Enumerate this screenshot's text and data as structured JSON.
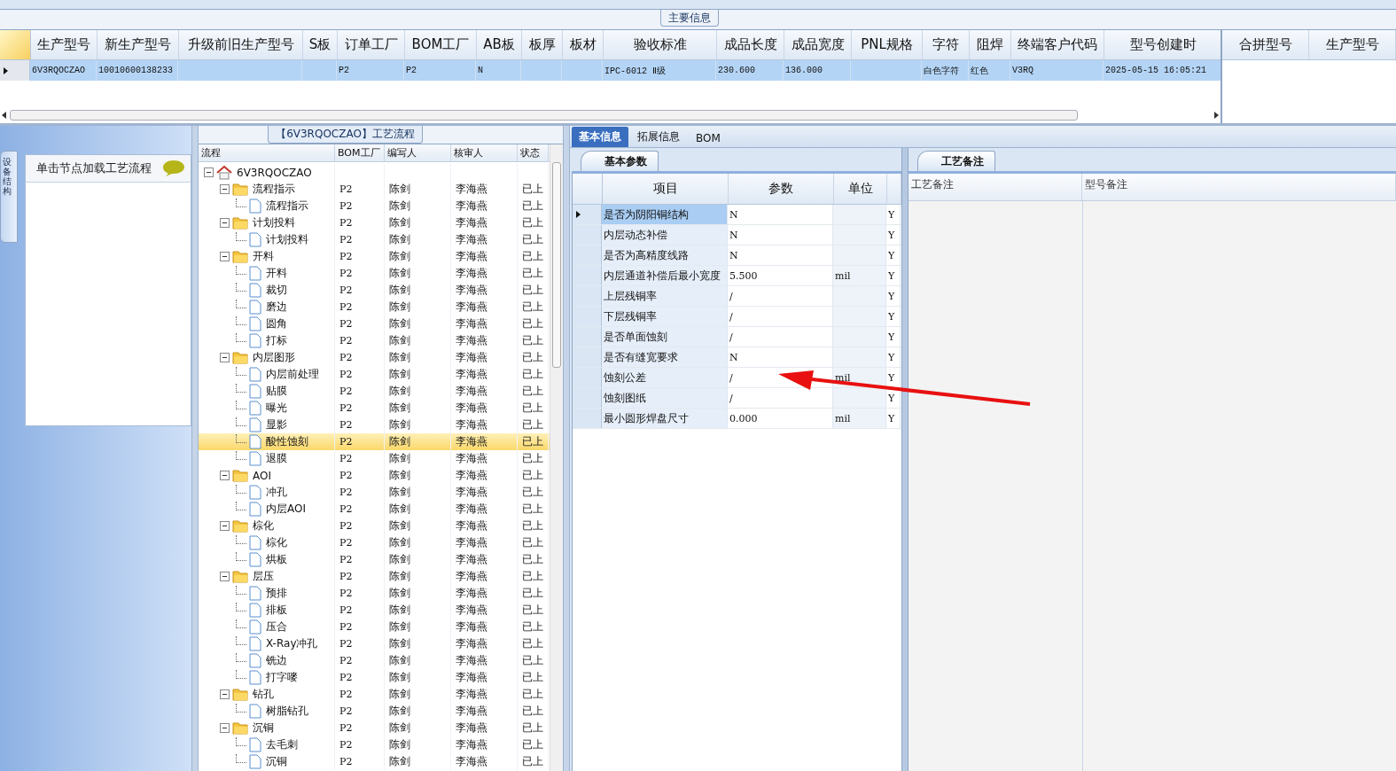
{
  "main_info": {
    "title": "主要信息",
    "columns": [
      "生产型号",
      "新生产型号",
      "升级前旧生产型号",
      "S板",
      "订单工厂",
      "BOM工厂",
      "AB板",
      "板厚",
      "板材",
      "验收标准",
      "成品长度",
      "成品宽度",
      "PNL规格",
      "字符",
      "阻焊",
      "终端客户代码",
      "型号创建时"
    ],
    "rows": [
      {
        "selected": true,
        "cells": [
          "6V3RQOCZAO",
          "10010600138233",
          "",
          "",
          "P2",
          "P2",
          "N",
          "",
          "",
          "IPC-6012 Ⅱ级",
          "230.600",
          "136.000",
          "",
          "白色字符",
          "红色",
          "V3RQ",
          "2025-05-15 16:05:21"
        ]
      }
    ],
    "side_columns": [
      "合拼型号",
      "生产型号"
    ]
  },
  "left_panel": {
    "tab": "设备结构",
    "hint": "单击节点加载工艺流程"
  },
  "process_flow": {
    "title": "【6V3RQOCZAO】工艺流程",
    "columns": [
      "流程",
      "BOM工厂",
      "编写人",
      "核审人",
      "状态"
    ],
    "root": {
      "kind": "root",
      "label": "6V3RQOCZAO",
      "expanded": true,
      "selected": false,
      "children": [
        {
          "kind": "folder",
          "label": "流程指示",
          "bom": "P2",
          "writer": "陈剑",
          "reviewer": "李海燕",
          "status": "已上",
          "expanded": true,
          "selected": false,
          "children": [
            {
              "kind": "file",
              "label": "流程指示",
              "bom": "P2",
              "writer": "陈剑",
              "reviewer": "李海燕",
              "status": "已上",
              "selected": false
            }
          ]
        },
        {
          "kind": "folder",
          "label": "计划投料",
          "bom": "P2",
          "writer": "陈剑",
          "reviewer": "李海燕",
          "status": "已上",
          "expanded": true,
          "selected": false,
          "children": [
            {
              "kind": "file",
              "label": "计划投料",
              "bom": "P2",
              "writer": "陈剑",
              "reviewer": "李海燕",
              "status": "已上",
              "selected": false
            }
          ]
        },
        {
          "kind": "folder",
          "label": "开料",
          "bom": "P2",
          "writer": "陈剑",
          "reviewer": "李海燕",
          "status": "已上",
          "expanded": true,
          "selected": false,
          "children": [
            {
              "kind": "file",
              "label": "开料",
              "bom": "P2",
              "writer": "陈剑",
              "reviewer": "李海燕",
              "status": "已上",
              "selected": false
            },
            {
              "kind": "file",
              "label": "裁切",
              "bom": "P2",
              "writer": "陈剑",
              "reviewer": "李海燕",
              "status": "已上",
              "selected": false
            },
            {
              "kind": "file",
              "label": "磨边",
              "bom": "P2",
              "writer": "陈剑",
              "reviewer": "李海燕",
              "status": "已上",
              "selected": false
            },
            {
              "kind": "file",
              "label": "圆角",
              "bom": "P2",
              "writer": "陈剑",
              "reviewer": "李海燕",
              "status": "已上",
              "selected": false
            },
            {
              "kind": "file",
              "label": "打标",
              "bom": "P2",
              "writer": "陈剑",
              "reviewer": "李海燕",
              "status": "已上",
              "selected": false
            }
          ]
        },
        {
          "kind": "folder",
          "label": "内层图形",
          "bom": "P2",
          "writer": "陈剑",
          "reviewer": "李海燕",
          "status": "已上",
          "expanded": true,
          "selected": false,
          "children": [
            {
              "kind": "file",
              "label": "内层前处理",
              "bom": "P2",
              "writer": "陈剑",
              "reviewer": "李海燕",
              "status": "已上",
              "selected": false
            },
            {
              "kind": "file",
              "label": "贴膜",
              "bom": "P2",
              "writer": "陈剑",
              "reviewer": "李海燕",
              "status": "已上",
              "selected": false
            },
            {
              "kind": "file",
              "label": "曝光",
              "bom": "P2",
              "writer": "陈剑",
              "reviewer": "李海燕",
              "status": "已上",
              "selected": false
            },
            {
              "kind": "file",
              "label": "显影",
              "bom": "P2",
              "writer": "陈剑",
              "reviewer": "李海燕",
              "status": "已上",
              "selected": false
            },
            {
              "kind": "file",
              "label": "酸性蚀刻",
              "bom": "P2",
              "writer": "陈剑",
              "reviewer": "李海燕",
              "status": "已上",
              "selected": true
            },
            {
              "kind": "file",
              "label": "退膜",
              "bom": "P2",
              "writer": "陈剑",
              "reviewer": "李海燕",
              "status": "已上",
              "selected": false
            }
          ]
        },
        {
          "kind": "folder",
          "label": "AOI",
          "bom": "P2",
          "writer": "陈剑",
          "reviewer": "李海燕",
          "status": "已上",
          "expanded": true,
          "selected": false,
          "children": [
            {
              "kind": "file",
              "label": "冲孔",
              "bom": "P2",
              "writer": "陈剑",
              "reviewer": "李海燕",
              "status": "已上",
              "selected": false
            },
            {
              "kind": "file",
              "label": "内层AOI",
              "bom": "P2",
              "writer": "陈剑",
              "reviewer": "李海燕",
              "status": "已上",
              "selected": false
            }
          ]
        },
        {
          "kind": "folder",
          "label": "棕化",
          "bom": "P2",
          "writer": "陈剑",
          "reviewer": "李海燕",
          "status": "已上",
          "expanded": true,
          "selected": false,
          "children": [
            {
              "kind": "file",
              "label": "棕化",
              "bom": "P2",
              "writer": "陈剑",
              "reviewer": "李海燕",
              "status": "已上",
              "selected": false
            },
            {
              "kind": "file",
              "label": "烘板",
              "bom": "P2",
              "writer": "陈剑",
              "reviewer": "李海燕",
              "status": "已上",
              "selected": false
            }
          ]
        },
        {
          "kind": "folder",
          "label": "层压",
          "bom": "P2",
          "writer": "陈剑",
          "reviewer": "李海燕",
          "status": "已上",
          "expanded": true,
          "selected": false,
          "children": [
            {
              "kind": "file",
              "label": "预排",
              "bom": "P2",
              "writer": "陈剑",
              "reviewer": "李海燕",
              "status": "已上",
              "selected": false
            },
            {
              "kind": "file",
              "label": "排板",
              "bom": "P2",
              "writer": "陈剑",
              "reviewer": "李海燕",
              "status": "已上",
              "selected": false
            },
            {
              "kind": "file",
              "label": "压合",
              "bom": "P2",
              "writer": "陈剑",
              "reviewer": "李海燕",
              "status": "已上",
              "selected": false
            },
            {
              "kind": "file",
              "label": "X-Ray冲孔",
              "bom": "P2",
              "writer": "陈剑",
              "reviewer": "李海燕",
              "status": "已上",
              "selected": false
            },
            {
              "kind": "file",
              "label": "铣边",
              "bom": "P2",
              "writer": "陈剑",
              "reviewer": "李海燕",
              "status": "已上",
              "selected": false
            },
            {
              "kind": "file",
              "label": "打字嘜",
              "bom": "P2",
              "writer": "陈剑",
              "reviewer": "李海燕",
              "status": "已上",
              "selected": false
            }
          ]
        },
        {
          "kind": "folder",
          "label": "钻孔",
          "bom": "P2",
          "writer": "陈剑",
          "reviewer": "李海燕",
          "status": "已上",
          "expanded": true,
          "selected": false,
          "children": [
            {
              "kind": "file",
              "label": "树脂钻孔",
              "bom": "P2",
              "writer": "陈剑",
              "reviewer": "李海燕",
              "status": "已上",
              "selected": false
            }
          ]
        },
        {
          "kind": "folder",
          "label": "沉铜",
          "bom": "P2",
          "writer": "陈剑",
          "reviewer": "李海燕",
          "status": "已上",
          "expanded": true,
          "selected": false,
          "children": [
            {
              "kind": "file",
              "label": "去毛刺",
              "bom": "P2",
              "writer": "陈剑",
              "reviewer": "李海燕",
              "status": "已上",
              "selected": false
            },
            {
              "kind": "file",
              "label": "沉铜",
              "bom": "P2",
              "writer": "陈剑",
              "reviewer": "李海燕",
              "status": "已上",
              "selected": false
            }
          ]
        }
      ]
    }
  },
  "detail_tabs": [
    {
      "label": "基本信息",
      "selected": true
    },
    {
      "label": "拓展信息",
      "selected": false
    },
    {
      "label": "BOM",
      "selected": false
    }
  ],
  "basic_params": {
    "tab": "基本参数",
    "columns": [
      "项目",
      "参数",
      "单位"
    ],
    "rows": [
      {
        "item": "是否为阴阳铜结构",
        "value": "N",
        "unit": "",
        "flag": "Y",
        "selected": true
      },
      {
        "item": "内层动态补偿",
        "value": "N",
        "unit": "",
        "flag": "Y",
        "selected": false
      },
      {
        "item": "是否为高精度线路",
        "value": "N",
        "unit": "",
        "flag": "Y",
        "selected": false
      },
      {
        "item": "内层通道补偿后最小宽度",
        "value": "5.500",
        "unit": "mil",
        "flag": "Y",
        "selected": false
      },
      {
        "item": "上层残铜率",
        "value": "/",
        "unit": "",
        "flag": "Y",
        "selected": false
      },
      {
        "item": "下层残铜率",
        "value": "/",
        "unit": "",
        "flag": "Y",
        "selected": false
      },
      {
        "item": "是否单面蚀刻",
        "value": "/",
        "unit": "",
        "flag": "Y",
        "selected": false
      },
      {
        "item": "是否有缝宽要求",
        "value": "N",
        "unit": "",
        "flag": "Y",
        "selected": false
      },
      {
        "item": "蚀刻公差",
        "value": "/",
        "unit": "mil",
        "flag": "Y",
        "selected": false
      },
      {
        "item": "蚀刻图纸",
        "value": "/",
        "unit": "",
        "flag": "Y",
        "selected": false
      },
      {
        "item": "最小圆形焊盘尺寸",
        "value": "0.000",
        "unit": "mil",
        "flag": "Y",
        "selected": false
      }
    ]
  },
  "process_notes": {
    "tab": "工艺备注",
    "columns": [
      "工艺备注",
      "型号备注"
    ]
  }
}
